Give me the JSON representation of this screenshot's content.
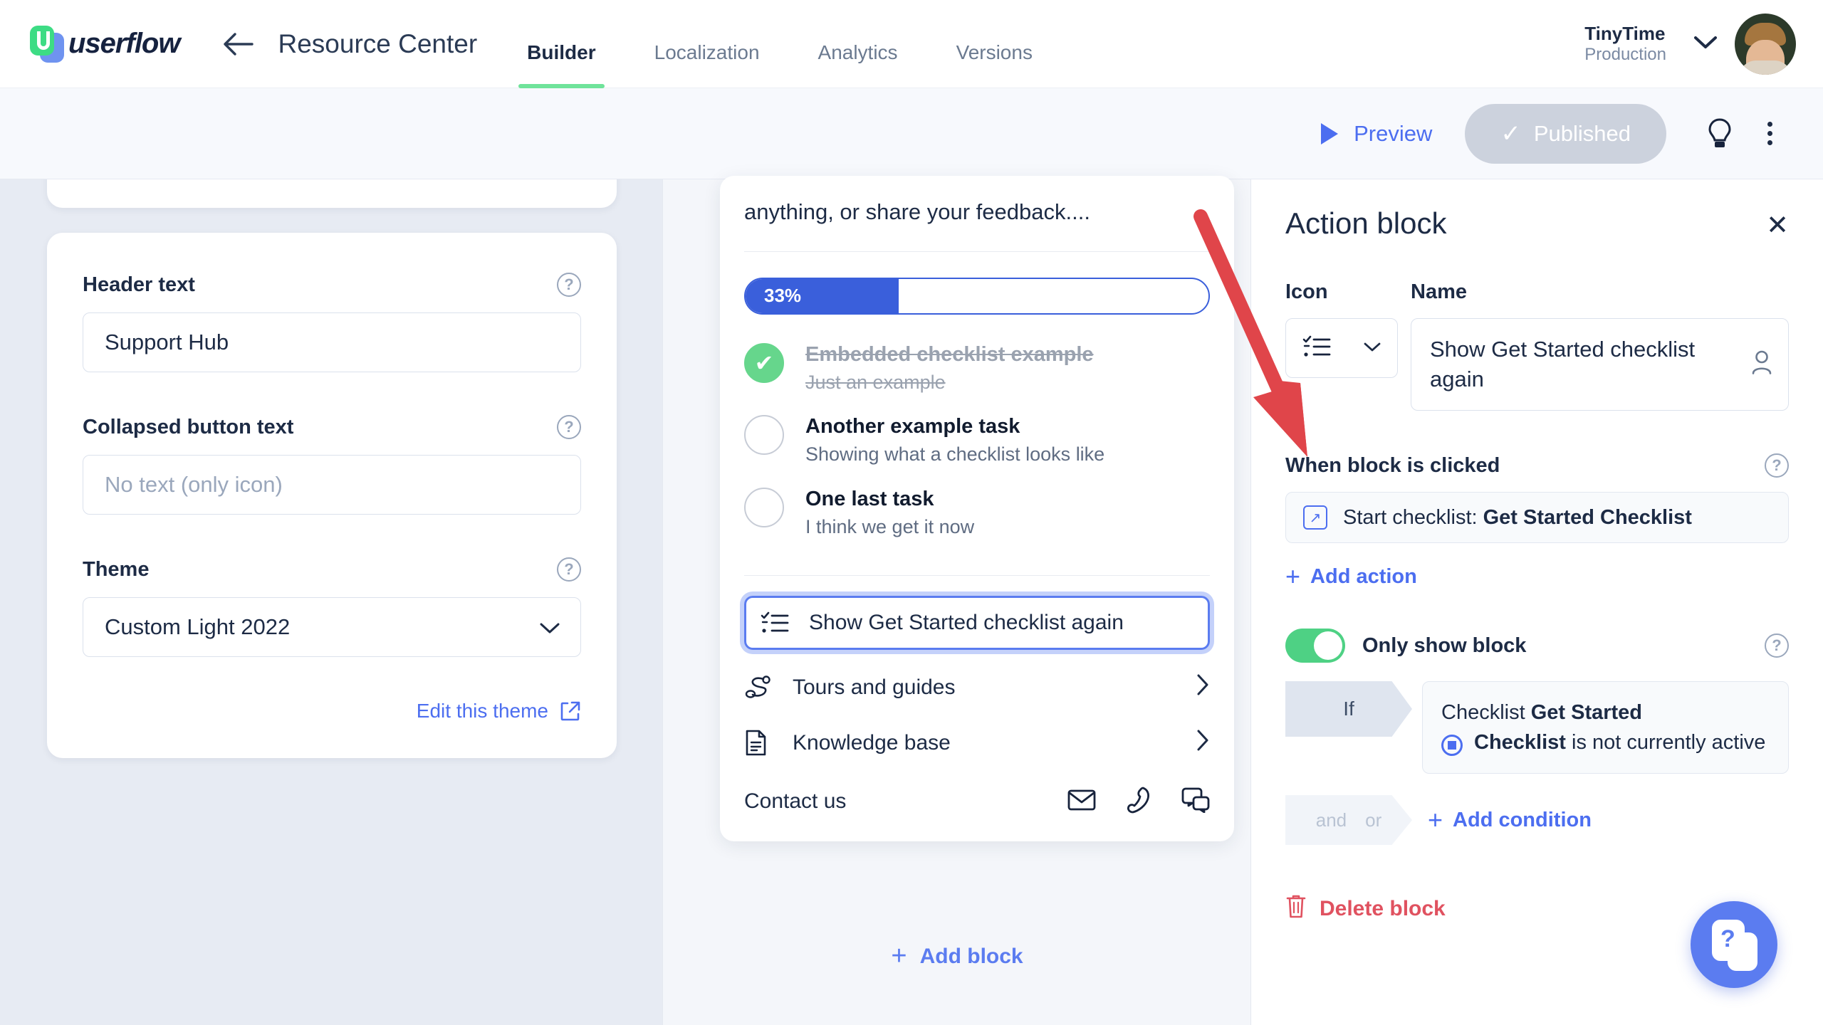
{
  "topnav": {
    "brand": "userflow",
    "back_icon": "back-arrow-icon",
    "page_title": "Resource Center",
    "tabs": [
      {
        "label": "Builder",
        "active": true
      },
      {
        "label": "Localization",
        "active": false
      },
      {
        "label": "Analytics",
        "active": false
      },
      {
        "label": "Versions",
        "active": false
      }
    ],
    "account": {
      "name": "TinyTime",
      "environment": "Production"
    }
  },
  "toolbar": {
    "preview_label": "Preview",
    "published_label": "Published",
    "published_check": "✓",
    "lightbulb_icon": "lightbulb-icon",
    "more_icon": "kebab-menu-icon"
  },
  "left_panel": {
    "fields": [
      {
        "label": "Header text",
        "value": "Support Hub",
        "placeholder": "",
        "is_placeholder": false,
        "type": "text"
      },
      {
        "label": "Collapsed button text",
        "value": "No text (only icon)",
        "placeholder": "No text (only icon)",
        "is_placeholder": true,
        "type": "text"
      },
      {
        "label": "Theme",
        "value": "Custom Light 2022",
        "placeholder": "",
        "is_placeholder": false,
        "type": "select"
      }
    ],
    "edit_theme_link": "Edit this theme"
  },
  "preview": {
    "intro_text": "anything, or share your feedback....",
    "progress": {
      "percent_label": "33%",
      "percent_value": 33
    },
    "tasks": [
      {
        "title": "Embedded checklist example",
        "subtitle": "Just an example",
        "completed": true
      },
      {
        "title": "Another example task",
        "subtitle": "Showing what a checklist looks like",
        "completed": false
      },
      {
        "title": "One last task",
        "subtitle": "I think we get it now",
        "completed": false
      }
    ],
    "menu_items": [
      {
        "label": "Show Get Started checklist again",
        "icon": "checklist-icon",
        "selected": true,
        "has_chevron": false
      },
      {
        "label": "Tours and guides",
        "icon": "tours-icon",
        "selected": false,
        "has_chevron": true
      },
      {
        "label": "Knowledge base",
        "icon": "document-icon",
        "selected": false,
        "has_chevron": true
      }
    ],
    "contact": {
      "label": "Contact us",
      "icons": [
        "mail-icon",
        "phone-icon",
        "chat-icon"
      ]
    },
    "add_block_label": "Add block",
    "add_block_plus": "+"
  },
  "right_panel": {
    "title": "Action block",
    "close_icon": "close-icon",
    "icon_label": "Icon",
    "name_label": "Name",
    "icon_value": "checklist-icon",
    "name_value": "Show Get Started checklist again",
    "when_clicked": {
      "label": "When block is clicked",
      "action_prefix": "Start checklist: ",
      "action_target": "Get Started Checklist",
      "add_action_label": "Add action",
      "add_action_plus": "+"
    },
    "only_show_block": {
      "label": "Only show block",
      "enabled": true,
      "if_label": "If",
      "condition_line1_prefix": "Checklist ",
      "condition_line1_bold": "Get Started",
      "condition_line2_bold": "Checklist",
      "condition_line2_rest": " is not currently active",
      "and_label": "and",
      "or_label": "or",
      "add_condition_label": "Add condition",
      "add_condition_plus": "+"
    },
    "delete_label": "Delete block"
  },
  "annotation": {
    "arrow_color": "#e0454a"
  },
  "help": {
    "icon": "help-widget-icon",
    "glyph": "?"
  },
  "colors": {
    "accent_blue": "#4c6ef0",
    "progress_blue": "#3a5fdb",
    "success_green": "#66d68c",
    "tab_underline_green": "#6fe39a",
    "danger_red": "#e05260",
    "left_bg": "#e7ebf3",
    "center_bg": "#f4f6fa"
  }
}
